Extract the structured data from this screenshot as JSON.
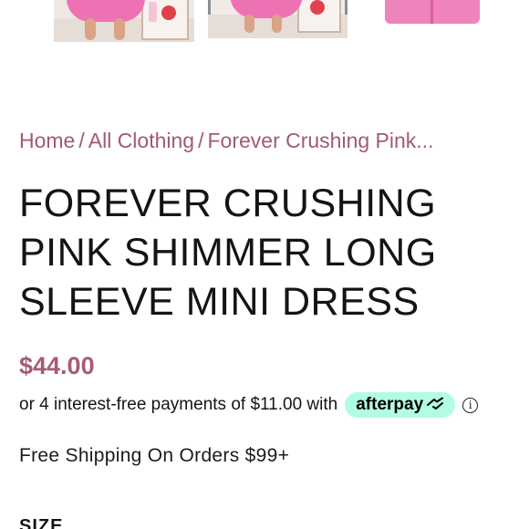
{
  "gallery": {
    "thumbnails": [
      {
        "alt": "thumbnail-1"
      },
      {
        "alt": "thumbnail-2",
        "selected": true
      },
      {
        "alt": "thumbnail-3"
      }
    ],
    "colors": {
      "dress_pink": "#ee72b3",
      "selected_border": "#8a8f93"
    }
  },
  "breadcrumb": {
    "items": [
      "Home",
      "All Clothing",
      "Forever Crushing Pink..."
    ],
    "separator": "/"
  },
  "product": {
    "title": "FOREVER CRUSHING PINK SHIMMER LONG SLEEVE MINI DRESS",
    "price": "$44.00"
  },
  "afterpay": {
    "text": "or 4 interest-free payments of $11.00 with",
    "badge_label": "afterpay",
    "badge_icon": "afterpay-arrows-icon",
    "info_icon": "info-icon",
    "info_glyph": "i",
    "badge_color": "#b2fce4"
  },
  "shipping": {
    "text": "Free Shipping On Orders $99+"
  },
  "size": {
    "label": "SIZE"
  },
  "colors": {
    "accent": "#a25a6e",
    "price": "#a55d70",
    "text": "#141414"
  }
}
